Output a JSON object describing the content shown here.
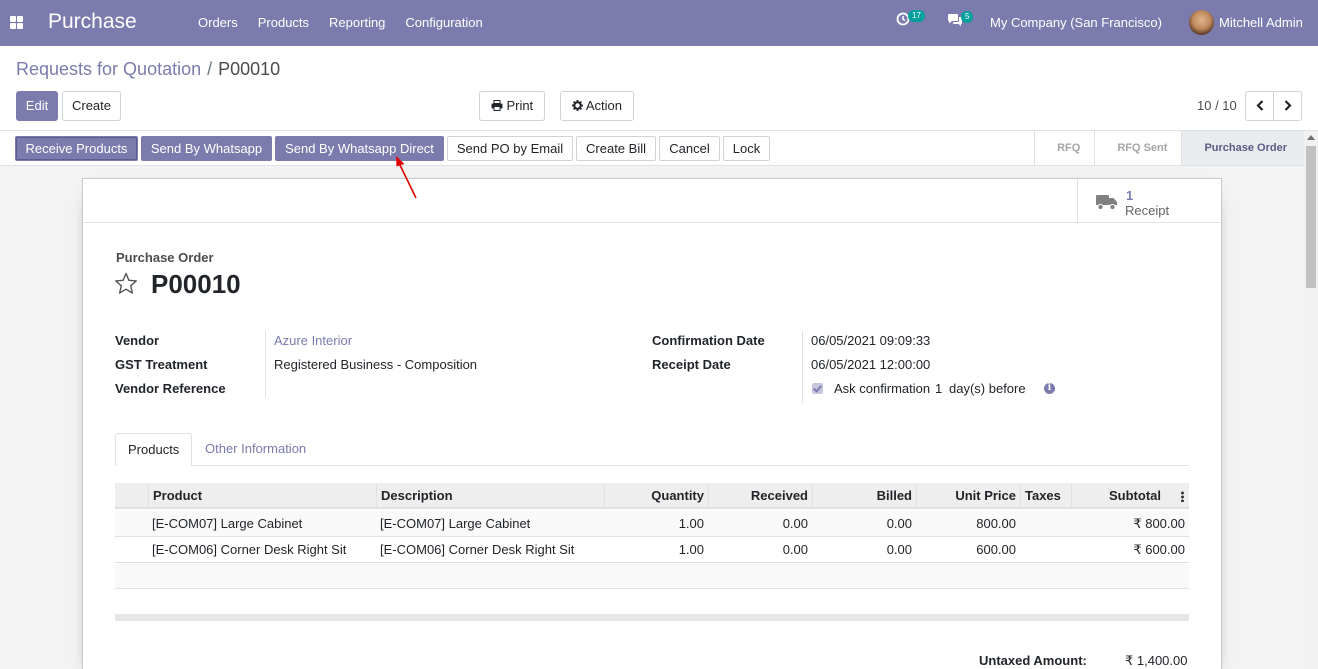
{
  "navbar": {
    "app_title": "Purchase",
    "menu": [
      "Orders",
      "Products",
      "Reporting",
      "Configuration"
    ],
    "activity_count": "17",
    "message_count": "5",
    "company": "My Company (San Francisco)",
    "user": "Mitchell Admin"
  },
  "breadcrumb": {
    "parent": "Requests for Quotation",
    "separator": "/",
    "current": "P00010"
  },
  "toolbar": {
    "edit": "Edit",
    "create": "Create",
    "print": "Print",
    "action": "Action",
    "pager": "10 / 10"
  },
  "statusbar": {
    "buttons": [
      "Receive Products",
      "Send By Whatsapp",
      "Send By Whatsapp Direct",
      "Send PO by Email",
      "Create Bill",
      "Cancel",
      "Lock"
    ],
    "stages": [
      "RFQ",
      "RFQ Sent",
      "Purchase Order"
    ],
    "active_stage": "Purchase Order"
  },
  "smart_button": {
    "count": "1",
    "label": "Receipt"
  },
  "form": {
    "doc_label": "Purchase Order",
    "doc_name": "P00010",
    "vendor_label": "Vendor",
    "vendor": "Azure Interior",
    "gst_label": "GST Treatment",
    "gst": "Registered Business - Composition",
    "vendor_ref_label": "Vendor Reference",
    "confirmation_label": "Confirmation Date",
    "confirmation": "06/05/2021 09:09:33",
    "receipt_label": "Receipt Date",
    "receipt": "06/05/2021 12:00:00",
    "ask_confirmation_text": "Ask confirmation",
    "ask_days": "1",
    "ask_suffix": "day(s) before",
    "ask_checked": true
  },
  "tabs": [
    "Products",
    "Other Information"
  ],
  "order_lines": {
    "columns": [
      "Product",
      "Description",
      "Quantity",
      "Received",
      "Billed",
      "Unit Price",
      "Taxes",
      "Subtotal"
    ],
    "rows": [
      [
        "[E-COM07] Large Cabinet",
        "[E-COM07] Large Cabinet",
        "1.00",
        "0.00",
        "0.00",
        "800.00",
        "",
        "₹ 800.00"
      ],
      [
        "[E-COM06] Corner Desk Right Sit",
        "[E-COM06] Corner Desk Right Sit",
        "1.00",
        "0.00",
        "0.00",
        "600.00",
        "",
        "₹ 600.00"
      ]
    ]
  },
  "totals": {
    "untaxed_label": "Untaxed Amount:",
    "untaxed": "₹ 1,400.00"
  },
  "colors": {
    "primary": "#7c7bad",
    "annotation_arrow": "#e00000"
  }
}
